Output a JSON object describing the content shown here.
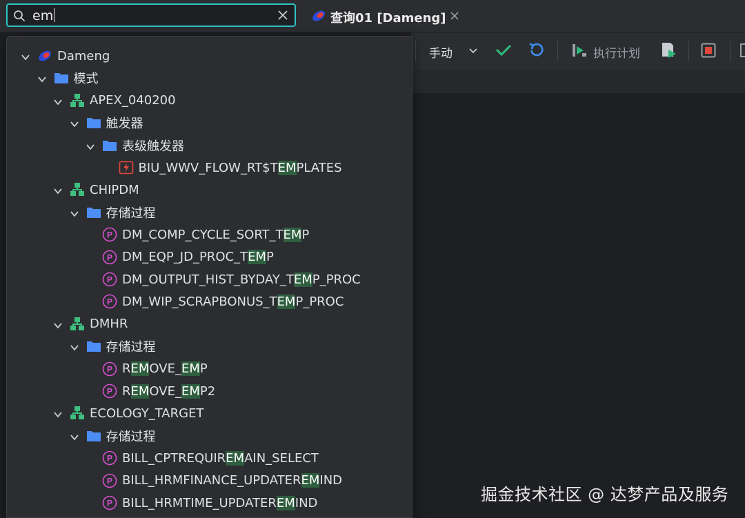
{
  "search": {
    "value": "em"
  },
  "tab": {
    "label": "查询01 [Dameng]"
  },
  "toolbar": {
    "commit_mode": "手动",
    "plan_label": "执行计划"
  },
  "tree": [
    {
      "level": 0,
      "type": "db",
      "parts": [
        [
          "Dameng",
          false
        ]
      ]
    },
    {
      "level": 1,
      "type": "folder",
      "parts": [
        [
          "模式",
          false
        ]
      ]
    },
    {
      "level": 2,
      "type": "schema",
      "parts": [
        [
          "APEX_040200",
          false
        ]
      ]
    },
    {
      "level": 3,
      "type": "folder",
      "parts": [
        [
          "触发器",
          false
        ]
      ]
    },
    {
      "level": 4,
      "type": "folder",
      "parts": [
        [
          "表级触发器",
          false
        ]
      ]
    },
    {
      "level": 5,
      "type": "trigger",
      "parts": [
        [
          "BIU_WWV_FLOW_RT$T",
          false
        ],
        [
          "EM",
          true
        ],
        [
          "PLATES",
          false
        ]
      ]
    },
    {
      "level": 2,
      "type": "schema",
      "parts": [
        [
          "CHIPDM",
          false
        ]
      ]
    },
    {
      "level": 3,
      "type": "folder",
      "parts": [
        [
          "存储过程",
          false
        ]
      ]
    },
    {
      "level": 4,
      "type": "proc",
      "parts": [
        [
          "DM_COMP_CYCLE_SORT_T",
          false
        ],
        [
          "EM",
          true
        ],
        [
          "P",
          false
        ]
      ]
    },
    {
      "level": 4,
      "type": "proc",
      "parts": [
        [
          "DM_EQP_JD_PROC_T",
          false
        ],
        [
          "EM",
          true
        ],
        [
          "P",
          false
        ]
      ]
    },
    {
      "level": 4,
      "type": "proc",
      "parts": [
        [
          "DM_OUTPUT_HIST_BYDAY_T",
          false
        ],
        [
          "EM",
          true
        ],
        [
          "P_PROC",
          false
        ]
      ]
    },
    {
      "level": 4,
      "type": "proc",
      "parts": [
        [
          "DM_WIP_SCRAPBONUS_T",
          false
        ],
        [
          "EM",
          true
        ],
        [
          "P_PROC",
          false
        ]
      ]
    },
    {
      "level": 2,
      "type": "schema",
      "parts": [
        [
          "DMHR",
          false
        ]
      ]
    },
    {
      "level": 3,
      "type": "folder",
      "parts": [
        [
          "存储过程",
          false
        ]
      ]
    },
    {
      "level": 4,
      "type": "proc",
      "parts": [
        [
          "R",
          false
        ],
        [
          "EM",
          true
        ],
        [
          "OVE_",
          false
        ],
        [
          "EM",
          true
        ],
        [
          "P",
          false
        ]
      ]
    },
    {
      "level": 4,
      "type": "proc",
      "parts": [
        [
          "R",
          false
        ],
        [
          "EM",
          true
        ],
        [
          "OVE_",
          false
        ],
        [
          "EM",
          true
        ],
        [
          "P2",
          false
        ]
      ]
    },
    {
      "level": 2,
      "type": "schema",
      "parts": [
        [
          "ECOLOGY_TARGET",
          false
        ]
      ]
    },
    {
      "level": 3,
      "type": "folder",
      "parts": [
        [
          "存储过程",
          false
        ]
      ]
    },
    {
      "level": 4,
      "type": "proc",
      "parts": [
        [
          "BILL_CPTREQUIR",
          false
        ],
        [
          "EM",
          true
        ],
        [
          "AIN_SELECT",
          false
        ]
      ]
    },
    {
      "level": 4,
      "type": "proc",
      "parts": [
        [
          "BILL_HRMFINANCE_UPDATER",
          false
        ],
        [
          "EM",
          true
        ],
        [
          "IND",
          false
        ]
      ]
    },
    {
      "level": 4,
      "type": "proc",
      "parts": [
        [
          "BILL_HRMTIME_UPDATER",
          false
        ],
        [
          "EM",
          true
        ],
        [
          "IND",
          false
        ]
      ]
    }
  ],
  "watermark": "掘金技术社区 @ 达梦产品及服务",
  "colors": {
    "accent": "#2ec4c4",
    "match_highlight": "#2f5f3f",
    "schema_icon": "#3fbf7f",
    "proc_icon": "#d94fd0",
    "folder_icon": "#4c8df6"
  }
}
